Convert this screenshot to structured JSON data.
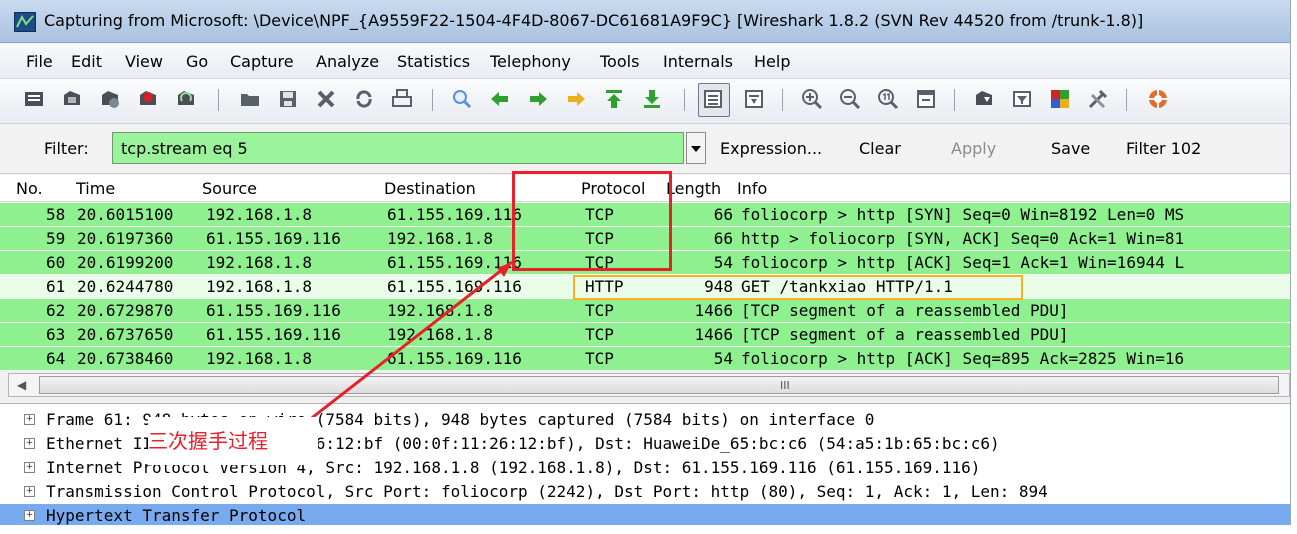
{
  "window": {
    "title": "Capturing from Microsoft: \\Device\\NPF_{A9559F22-1504-4F4D-8067-DC61681A9F9C}    [Wireshark 1.8.2  (SVN Rev 44520 from /trunk-1.8)]"
  },
  "menu": [
    "File",
    "Edit",
    "View",
    "Go",
    "Capture",
    "Analyze",
    "Statistics",
    "Telephony",
    "Tools",
    "Internals",
    "Help"
  ],
  "toolbar": {
    "icons": [
      "interfaces-icon",
      "options-icon",
      "start-capture-icon",
      "stop-capture-icon",
      "restart-capture-icon",
      "open-file-icon",
      "save-file-icon",
      "close-file-icon",
      "reload-icon",
      "print-icon",
      "find-icon",
      "go-back-icon",
      "go-forward-icon",
      "go-to-packet-icon",
      "go-first-icon",
      "go-last-icon",
      "colorize-icon",
      "autoscroll-icon",
      "zoom-in-icon",
      "zoom-out-icon",
      "zoom-normal-icon",
      "resize-columns-icon",
      "capture-filters-icon",
      "display-filters-icon",
      "coloring-rules-icon",
      "preferences-icon",
      "help-icon"
    ]
  },
  "filter": {
    "label": "Filter:",
    "value": "tcp.stream eq 5",
    "expression": "Expression...",
    "clear": "Clear",
    "apply": "Apply",
    "save": "Save",
    "saved_filter": "Filter 102"
  },
  "packet_list": {
    "columns": [
      "No.",
      "Time",
      "Source",
      "Destination",
      "Protocol",
      "Length",
      "Info"
    ],
    "rows": [
      {
        "no": "58",
        "time": "20.6015100",
        "source": "192.168.1.8",
        "destination": "61.155.169.116",
        "protocol": "TCP",
        "length": "66",
        "info": "foliocorp > http [SYN] Seq=0 Win=8192 Len=0 MS",
        "kind": "tcp"
      },
      {
        "no": "59",
        "time": "20.6197360",
        "source": "61.155.169.116",
        "destination": "192.168.1.8",
        "protocol": "TCP",
        "length": "66",
        "info": "http > foliocorp [SYN, ACK] Seq=0 Ack=1 Win=81",
        "kind": "tcp"
      },
      {
        "no": "60",
        "time": "20.6199200",
        "source": "192.168.1.8",
        "destination": "61.155.169.116",
        "protocol": "TCP",
        "length": "54",
        "info": "foliocorp > http [ACK] Seq=1 Ack=1 Win=16944 L",
        "kind": "tcp"
      },
      {
        "no": "61",
        "time": "20.6244780",
        "source": "192.168.1.8",
        "destination": "61.155.169.116",
        "protocol": "HTTP",
        "length": "948",
        "info": "GET /tankxiao HTTP/1.1",
        "kind": "http"
      },
      {
        "no": "62",
        "time": "20.6729870",
        "source": "61.155.169.116",
        "destination": "192.168.1.8",
        "protocol": "TCP",
        "length": "1466",
        "info": "[TCP segment of a reassembled PDU]",
        "kind": "tcp"
      },
      {
        "no": "63",
        "time": "20.6737650",
        "source": "61.155.169.116",
        "destination": "192.168.1.8",
        "protocol": "TCP",
        "length": "1466",
        "info": "[TCP segment of a reassembled PDU]",
        "kind": "tcp"
      },
      {
        "no": "64",
        "time": "20.6738460",
        "source": "192.168.1.8",
        "destination": "61.155.169.116",
        "protocol": "TCP",
        "length": "54",
        "info": "foliocorp > http [ACK] Seq=895 Ack=2825 Win=16",
        "kind": "tcp"
      }
    ],
    "scroll_grip": "III"
  },
  "details": [
    {
      "text": "Frame 61: 948 bytes on wire (7584 bits), 948 bytes captured (7584 bits) on interface 0",
      "selected": false
    },
    {
      "text": "Ethernet II, Src: AsustekC_26:12:bf (00:0f:11:26:12:bf), Dst: HuaweiDe_65:bc:c6 (54:a5:1b:65:bc:c6)",
      "selected": false
    },
    {
      "text": "Internet Protocol Version 4, Src: 192.168.1.8 (192.168.1.8), Dst: 61.155.169.116 (61.155.169.116)",
      "selected": false
    },
    {
      "text": "Transmission Control Protocol, Src Port: foliocorp (2242), Dst Port: http (80), Seq: 1, Ack: 1, Len: 894",
      "selected": false
    },
    {
      "text": "Hypertext Transfer Protocol",
      "selected": true
    }
  ],
  "annotation": {
    "label": "三次握手过程",
    "box_color": "#e8202a",
    "http_box_color": "#ffb020"
  },
  "colors": {
    "tcp_row": "#8ef08e",
    "http_row": "#e9fde9",
    "filter_ok": "#9af29a",
    "selected_detail": "#77aaee"
  }
}
